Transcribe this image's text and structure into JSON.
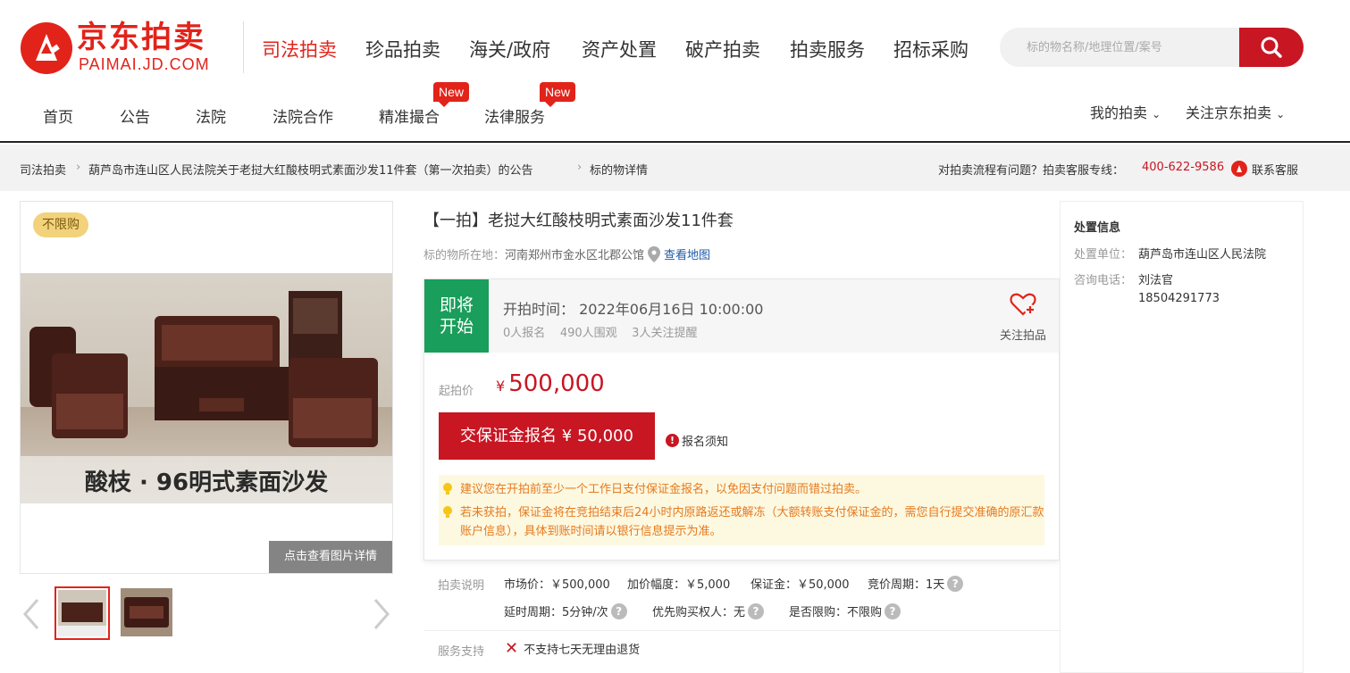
{
  "header": {
    "logo": {
      "cn": "京东拍卖",
      "en": "PAIMAI.JD.COM"
    },
    "top_nav": [
      "司法拍卖",
      "珍品拍卖",
      "海关/政府",
      "资产处置",
      "破产拍卖",
      "拍卖服务",
      "招标采购"
    ],
    "search_placeholder": "标的物名称/地理位置/案号",
    "sub_nav": [
      "首页",
      "公告",
      "法院",
      "法院合作",
      "精准撮合",
      "法律服务"
    ],
    "new_tag": "New",
    "right_nav": [
      "我的拍卖",
      "关注京东拍卖"
    ],
    "colors": {
      "brand": "#e2231a",
      "button": "#c81623"
    }
  },
  "breadcrumb": {
    "items": [
      "司法拍卖",
      "葫芦岛市连山区人民法院关于老挝大红酸枝明式素面沙发11件套（第一次拍卖）的公告",
      "标的物详情"
    ],
    "help_text": "对拍卖流程有问题？拍卖客服专线：",
    "phone": "400-622-9586",
    "contact": "联系客服"
  },
  "gallery": {
    "badge": "不限购",
    "photo_caption": "酸枝 · 96明式素面沙发",
    "view_details": "点击查看图片详情"
  },
  "item": {
    "title": "【一拍】老挝大红酸枝明式素面沙发11件套",
    "location_label": "标的物所在地：",
    "location": "河南郑州市金水区北郡公馆",
    "map_link": "查看地图",
    "status": "即将开始",
    "start_time": "开拍时间：  2022年06月16日 10:00:00",
    "stats": [
      "0人报名",
      "490人围观",
      "3人关注提醒"
    ],
    "follow": "关注拍品",
    "start_price_label": "起拍价",
    "currency": "¥",
    "start_price": "500,000",
    "deposit_button": "交保证金报名 ¥ 50,000",
    "notice": "报名须知",
    "tips": [
      "建议您在开拍前至少一个工作日支付保证金报名，以免因支付问题而错过拍卖。",
      "若未获拍，保证金将在竞拍结束后24小时内原路返还或解冻（大额转账支付保证金的，需您自行提交准确的原汇款账户信息），具体到账时间请以银行信息提示为准。"
    ]
  },
  "auction_info": {
    "label": "拍卖说明",
    "row1": [
      "市场价：￥500,000",
      "加价幅度：￥5,000",
      "保证金：￥50,000",
      "竞价周期：1天"
    ],
    "row2": [
      "延时周期：5分钟/次",
      "优先购买权人：无",
      "是否限购：不限购"
    ],
    "service_label": "服务支持",
    "service_value": "不支持七天无理由退货"
  },
  "dispose": {
    "title": "处置信息",
    "unit_label": "处置单位：",
    "unit": "葫芦岛市连山区人民法院",
    "phone_label": "咨询电话：",
    "contact": "刘法官",
    "phone": "18504291773"
  }
}
